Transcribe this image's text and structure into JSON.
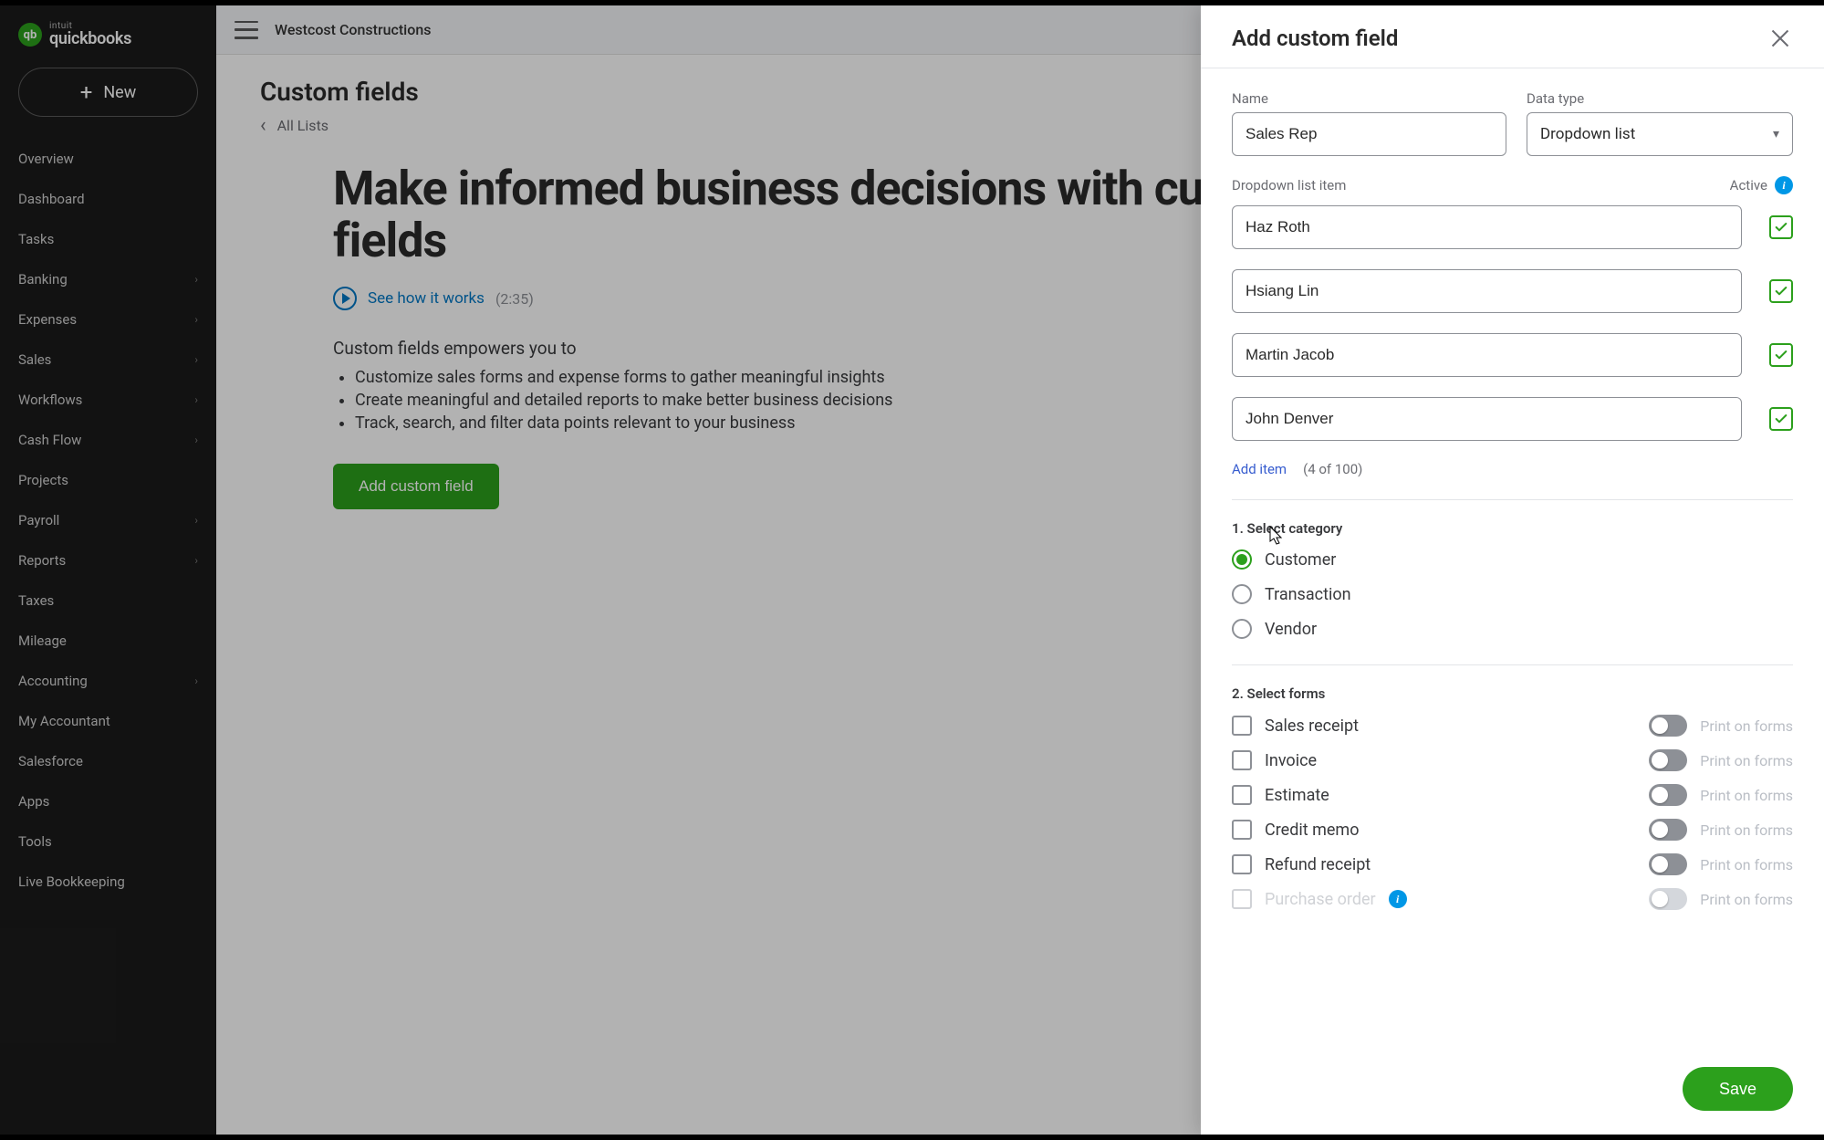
{
  "brand": {
    "intuit": "intuit",
    "qb": "quickbooks"
  },
  "new_button": "New",
  "nav": {
    "items": [
      {
        "label": "Overview",
        "chev": false
      },
      {
        "label": "Dashboard",
        "chev": false
      },
      {
        "label": "Tasks",
        "chev": false
      },
      {
        "label": "Banking",
        "chev": true
      },
      {
        "label": "Expenses",
        "chev": true
      },
      {
        "label": "Sales",
        "chev": true
      },
      {
        "label": "Workflows",
        "chev": true
      },
      {
        "label": "Cash Flow",
        "chev": true
      },
      {
        "label": "Projects",
        "chev": false
      },
      {
        "label": "Payroll",
        "chev": true
      },
      {
        "label": "Reports",
        "chev": true
      },
      {
        "label": "Taxes",
        "chev": false
      },
      {
        "label": "Mileage",
        "chev": false
      },
      {
        "label": "Accounting",
        "chev": true
      },
      {
        "label": "My Accountant",
        "chev": false
      },
      {
        "label": "Salesforce",
        "chev": false
      },
      {
        "label": "Apps",
        "chev": false
      },
      {
        "label": "Tools",
        "chev": false
      },
      {
        "label": "Live Bookkeeping",
        "chev": false
      }
    ]
  },
  "topbar": {
    "company": "Westcost Constructions"
  },
  "page": {
    "title": "Custom fields",
    "back": "All Lists",
    "hero_title": "Make informed business decisions with custom fields",
    "see_how": "See how it works",
    "duration": "(2:35)",
    "intro": "Custom fields empowers you to",
    "bullets": [
      "Customize sales forms and expense forms to gather meaningful insights",
      "Create meaningful and detailed reports to make better business decisions",
      "Track, search, and filter data points relevant to your business"
    ],
    "add_btn": "Add custom field"
  },
  "panel": {
    "title": "Add custom field",
    "name_label": "Name",
    "name_value": "Sales Rep",
    "type_label": "Data type",
    "type_value": "Dropdown list",
    "dd_label": "Dropdown list item",
    "active_label": "Active",
    "items": [
      {
        "value": "Haz Roth"
      },
      {
        "value": "Hsiang Lin"
      },
      {
        "value": "Martin Jacob"
      },
      {
        "value": "John Denver"
      }
    ],
    "add_item": "Add item",
    "count": "(4 of 100)",
    "cat_title": "1. Select category",
    "categories": [
      {
        "label": "Customer",
        "selected": true
      },
      {
        "label": "Transaction",
        "selected": false
      },
      {
        "label": "Vendor",
        "selected": false
      }
    ],
    "forms_title": "2. Select forms",
    "print_label": "Print on forms",
    "forms": [
      {
        "label": "Sales receipt",
        "disabled": false
      },
      {
        "label": "Invoice",
        "disabled": false
      },
      {
        "label": "Estimate",
        "disabled": false
      },
      {
        "label": "Credit memo",
        "disabled": false
      },
      {
        "label": "Refund receipt",
        "disabled": false
      },
      {
        "label": "Purchase order",
        "disabled": true
      }
    ],
    "save": "Save"
  }
}
